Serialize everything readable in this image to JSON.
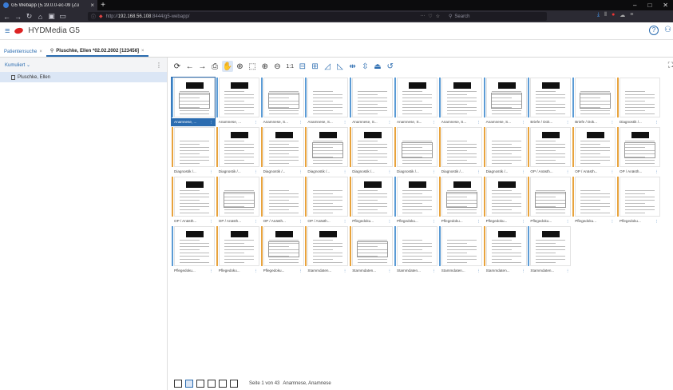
{
  "browser": {
    "tab_title": "G5 Webapp (5.19.0.0-ec-09 (Zü",
    "new_tab": "+",
    "url_prefix": "http://",
    "url_host": "192.168.56.108",
    "url_rest": ":8444/g5-webapp/",
    "search_placeholder": "Search",
    "win_min": "–",
    "win_max": "□",
    "win_close": "✕"
  },
  "app": {
    "title": "HYDMedia G5",
    "help": "?"
  },
  "tabs": [
    {
      "label": "Patientensuche",
      "close": "×"
    },
    {
      "label": "Pluschke, Ellen *02.02.2002 [123456]",
      "close": "×"
    }
  ],
  "leftpanel": {
    "dropdown_label": "Kumuliert ⌄",
    "menu": "⋮",
    "patient": "Pluschke, Ellen"
  },
  "toolbar": {
    "icons": [
      "⟳",
      "←",
      "→",
      "⎙",
      "✋",
      "⊕",
      "⬚",
      "⊕",
      "⊖",
      "1:1",
      "⊟",
      "⊞",
      "◿",
      "◺",
      "⇹",
      "⇳",
      "⏏",
      "↺"
    ],
    "active_index": 4,
    "right_icon": "⛶"
  },
  "documents": [
    {
      "label": "Anamnese, ...",
      "bar": "#5b9bd5",
      "sel": true
    },
    {
      "label": "Anamnese, ...",
      "bar": "#5b9bd5"
    },
    {
      "label": "Anamnese, S...",
      "bar": "#5b9bd5"
    },
    {
      "label": "Anamnese, S...",
      "bar": "#5b9bd5"
    },
    {
      "label": "Anamnese, S...",
      "bar": "#5b9bd5"
    },
    {
      "label": "Anamnese, S...",
      "bar": "#5b9bd5"
    },
    {
      "label": "Anamnese, S...",
      "bar": "#5b9bd5"
    },
    {
      "label": "Anamnese, S...",
      "bar": "#5b9bd5"
    },
    {
      "label": "Briefe / Dok...",
      "bar": "#5b9bd5"
    },
    {
      "label": "Briefe / Dok...",
      "bar": "#5b9bd5"
    },
    {
      "label": "Diagnostik /...",
      "bar": "#e8a33d"
    },
    {
      "label": "Diagnostik /...",
      "bar": "#e8a33d"
    },
    {
      "label": "Diagnostik /...",
      "bar": "#e8a33d"
    },
    {
      "label": "Diagnostik /...",
      "bar": "#e8a33d"
    },
    {
      "label": "Diagnostik /...",
      "bar": "#e8a33d"
    },
    {
      "label": "Diagnostik /...",
      "bar": "#e8a33d"
    },
    {
      "label": "Diagnostik /...",
      "bar": "#e8a33d"
    },
    {
      "label": "Diagnostik /...",
      "bar": "#e8a33d"
    },
    {
      "label": "Diagnostik /...",
      "bar": "#e8a33d"
    },
    {
      "label": "OP / Anästh...",
      "bar": "#e8a33d"
    },
    {
      "label": "OP / Anästh...",
      "bar": "#e8a33d"
    },
    {
      "label": "OP / Anästh...",
      "bar": "#e8a33d"
    },
    {
      "label": "OP / Anästh...",
      "bar": "#e8a33d"
    },
    {
      "label": "OP / Anästh...",
      "bar": "#e8a33d"
    },
    {
      "label": "OP / Anästh...",
      "bar": "#e8a33d"
    },
    {
      "label": "OP / Anästh...",
      "bar": "#e8a33d"
    },
    {
      "label": "Pflegedoku...",
      "bar": "#e8a33d"
    },
    {
      "label": "Pflegedoku...",
      "bar": "#5b9bd5"
    },
    {
      "label": "Pflegedoku...",
      "bar": "#e8a33d"
    },
    {
      "label": "Pflegedoku...",
      "bar": "#e8a33d"
    },
    {
      "label": "Pflegedoku...",
      "bar": "#e8a33d"
    },
    {
      "label": "Pflegedoku...",
      "bar": "#e8a33d"
    },
    {
      "label": "Pflegedoku...",
      "bar": "#e8a33d"
    },
    {
      "label": "Pflegedoku...",
      "bar": "#5b9bd5"
    },
    {
      "label": "Pflegedoku...",
      "bar": "#e8a33d"
    },
    {
      "label": "Pflegedoku...",
      "bar": "#e8a33d"
    },
    {
      "label": "Stammdaten...",
      "bar": "#e8a33d"
    },
    {
      "label": "Stammdaten...",
      "bar": "#e8a33d"
    },
    {
      "label": "Stammdaten...",
      "bar": "#5b9bd5"
    },
    {
      "label": "Stammdaten...",
      "bar": "#5b9bd5"
    },
    {
      "label": "Stammdaten...",
      "bar": "#e8a33d"
    },
    {
      "label": "Stammdaten...",
      "bar": "#5b9bd5"
    }
  ],
  "item_menu": "⋮",
  "bottom": {
    "page_info": "Seite 1 von 43",
    "doc_name": "Anamnese, Anamnese"
  }
}
